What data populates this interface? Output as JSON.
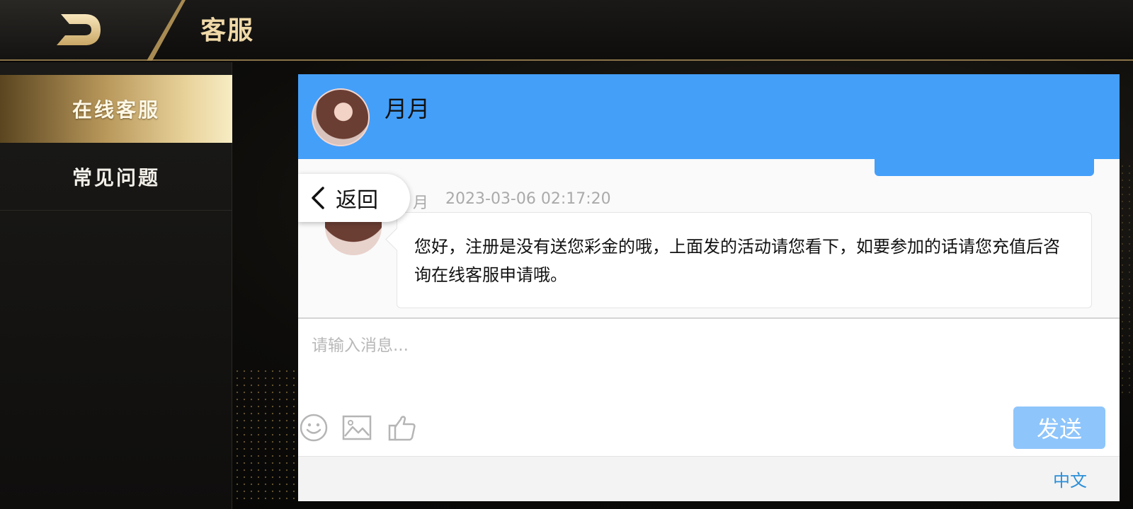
{
  "header": {
    "title": "客服"
  },
  "sidebar": {
    "items": [
      {
        "label": "在线客服",
        "active": true
      },
      {
        "label": "常见问题",
        "active": false
      }
    ]
  },
  "chat": {
    "agent_name": "月月",
    "return_label": "返回",
    "message": {
      "sender": "月",
      "timestamp": "2023-03-06 02:17:20",
      "text": "您好，注册是没有送您彩金的哦，上面发的活动请您看下，如要参加的话请您充值后咨询在线客服申请哦。"
    },
    "input": {
      "placeholder": "请输入消息...",
      "value": ""
    },
    "toolbar": {
      "icons": [
        "emoji-icon",
        "image-icon",
        "thumbs-up-icon"
      ]
    },
    "send_label": "发送",
    "language_label": "中文"
  },
  "colors": {
    "accent_blue": "#449ff9",
    "send_button": "#8ec5fb",
    "gold": "#d8be87",
    "link_blue": "#2b8fd8"
  }
}
